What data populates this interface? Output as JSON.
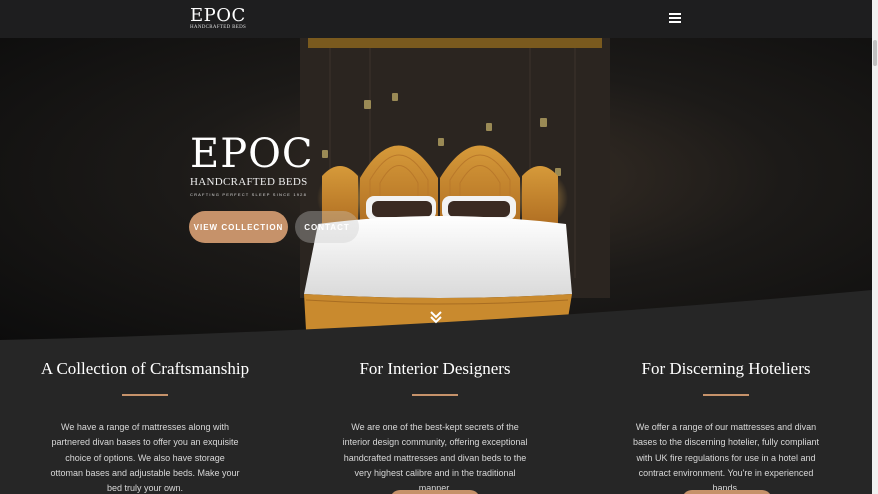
{
  "header": {
    "logo_main": "EPOC",
    "logo_sub": "HANDCRAFTED BEDS"
  },
  "hero": {
    "title": "EPOC",
    "subtitle": "HANDCRAFTED BEDS",
    "tagline": "CRAFTING PERFECT SLEEP SINCE 1928",
    "view_button": "VIEW COLLECTION",
    "contact_button": "CONTACT"
  },
  "columns": [
    {
      "title": "A Collection of Craftsmanship",
      "text": "We have a range of  mattresses along with partnered divan bases to offer you an exquisite choice of options. We also have storage ottoman bases and adjustable beds. Make your bed truly your own."
    },
    {
      "title": "For Interior Designers",
      "text": "We are one of the best-kept secrets of the interior design community, offering exceptional handcrafted mattresses and divan beds to the very highest calibre and in the traditional manner."
    },
    {
      "title": "For Discerning Hoteliers",
      "text": "We offer a range of our mattresses and divan bases to the discerning hotelier, fully compliant with UK fire regulations for use in a hotel and contract environment. You're in experienced hands."
    }
  ],
  "colors": {
    "accent": "#c6926a",
    "header_bg": "#1e1e1f",
    "section_bg": "#262626",
    "headboard": "#c98a2e"
  },
  "icons": {
    "menu": "hamburger-menu-icon",
    "scroll": "double-chevron-down-icon"
  }
}
